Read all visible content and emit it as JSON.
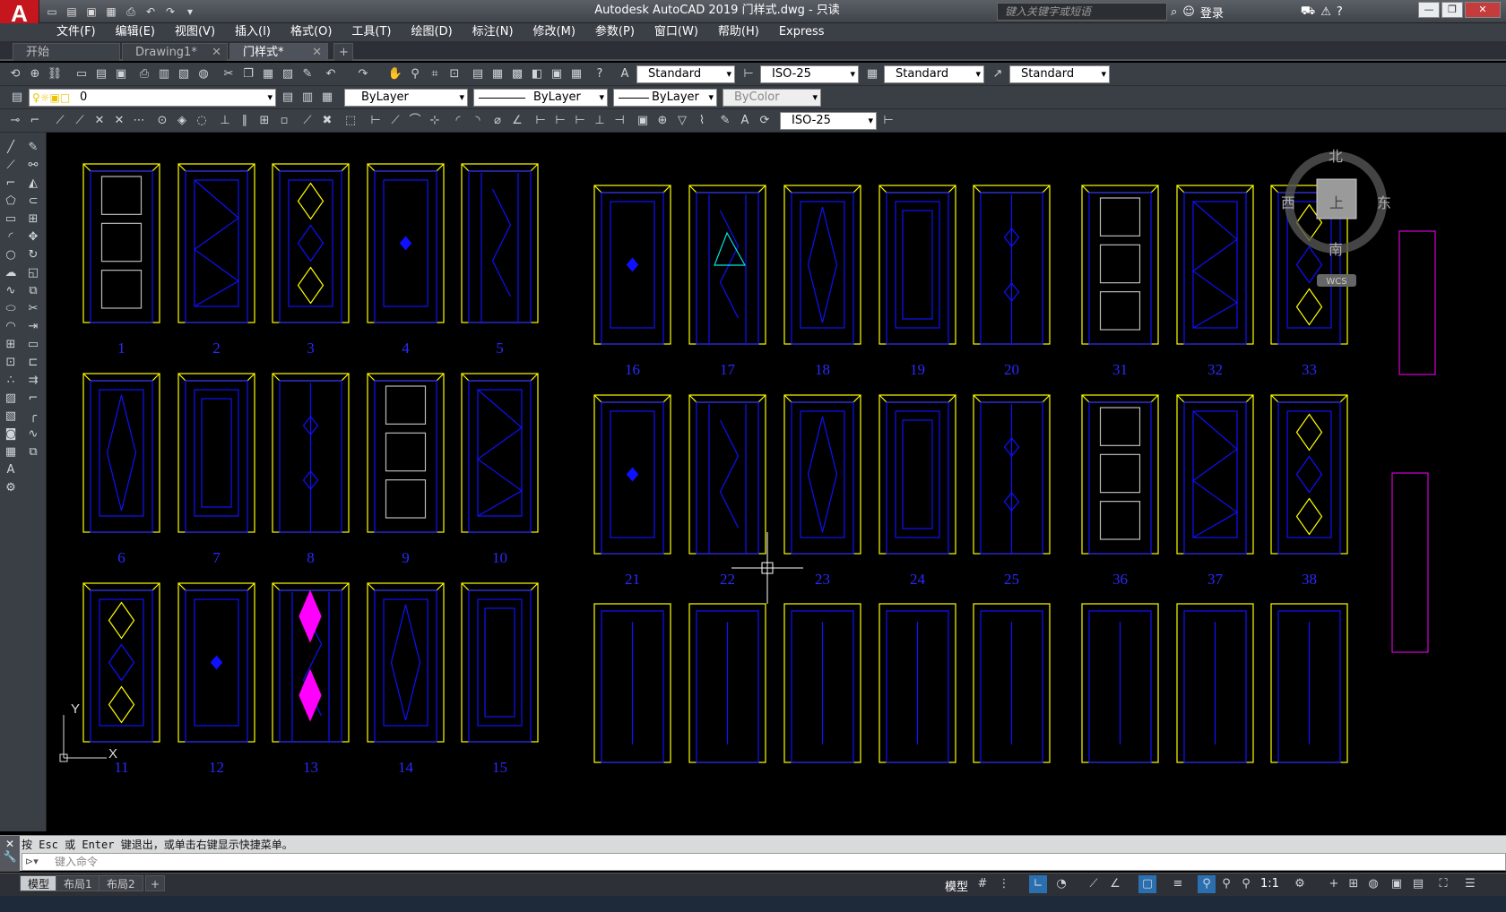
{
  "titlebar": {
    "app_logo": "A",
    "title": "Autodesk AutoCAD 2019    门样式.dwg - 只读",
    "search_placeholder": "键入关键字或短语",
    "login": "登录"
  },
  "menu": [
    "文件(F)",
    "编辑(E)",
    "视图(V)",
    "插入(I)",
    "格式(O)",
    "工具(T)",
    "绘图(D)",
    "标注(N)",
    "修改(M)",
    "参数(P)",
    "窗口(W)",
    "帮助(H)",
    "Express"
  ],
  "tabs": [
    {
      "label": "开始",
      "active": false
    },
    {
      "label": "Drawing1*",
      "active": false
    },
    {
      "label": "门样式*",
      "active": true
    }
  ],
  "toolbar1": {
    "text_style": "Standard",
    "dim_style": "ISO-25",
    "table_style": "Standard",
    "mleader_style": "Standard"
  },
  "toolbar2": {
    "layer": "0",
    "color": "ByLayer",
    "linetype": "ByLayer",
    "lineweight": "ByLayer",
    "plotstyle": "ByColor"
  },
  "toolbar3": {
    "dim_style": "ISO-25"
  },
  "viewcube": {
    "north": "北",
    "south": "南",
    "east": "东",
    "west": "西",
    "top": "上",
    "wcs": "WCS"
  },
  "ucs": {
    "x": "X",
    "y": "Y"
  },
  "doors_left": [
    "1",
    "2",
    "3",
    "4",
    "5",
    "6",
    "7",
    "8",
    "9",
    "10",
    "11",
    "12",
    "13",
    "14",
    "15"
  ],
  "doors_right": [
    "16",
    "17",
    "18",
    "19",
    "20",
    "31",
    "32",
    "33",
    "21",
    "22",
    "23",
    "24",
    "25",
    "36",
    "37",
    "38"
  ],
  "command": {
    "history": "按 Esc 或 Enter 键退出，或单击右键显示快捷菜单。",
    "placeholder": "键入命令"
  },
  "layout_tabs": [
    "模型",
    "布局1",
    "布局2"
  ],
  "status": {
    "model": "模型",
    "scale": "1:1"
  },
  "colors": {
    "frame": "#ffff00",
    "panel": "#1010ff",
    "accent": "#ff00ff",
    "bg": "#000000"
  }
}
